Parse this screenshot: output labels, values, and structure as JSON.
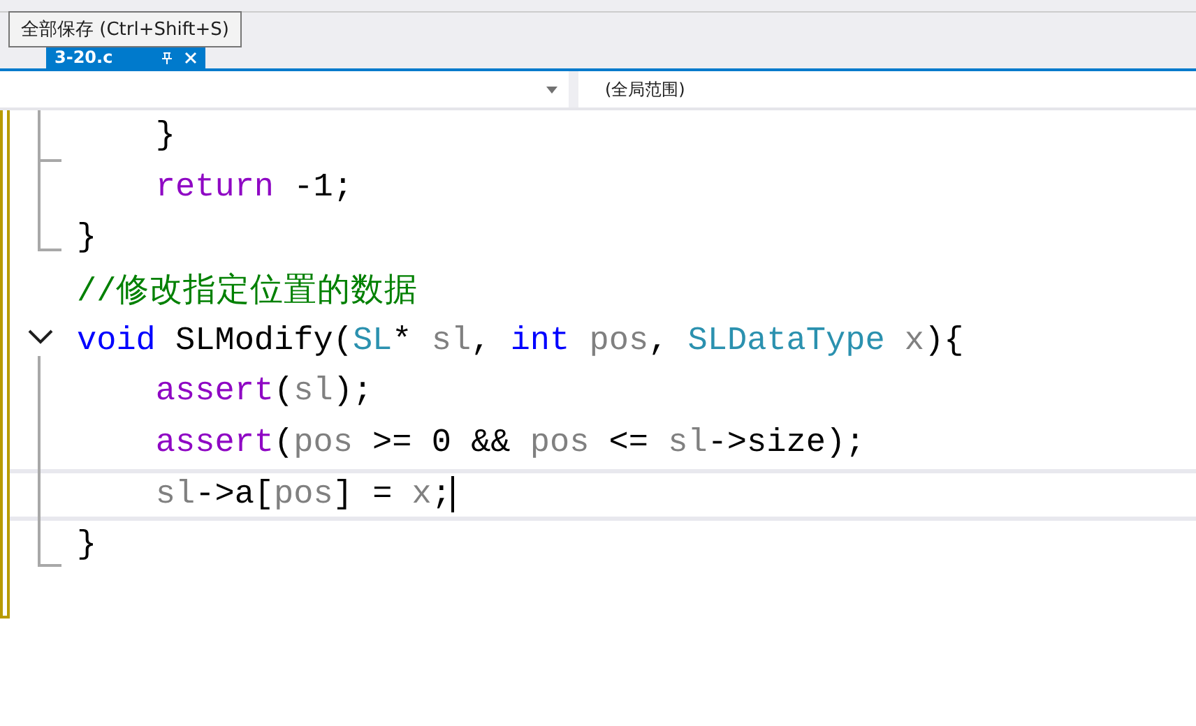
{
  "tooltip": {
    "text": "全部保存 (Ctrl+Shift+S)"
  },
  "tabs": [
    {
      "label": "3-20.c",
      "selected": true
    }
  ],
  "navigation_bar": {
    "scope": "(全局范围)"
  },
  "editor": {
    "lines": [
      {
        "tokens": [
          {
            "text": "    }",
            "kind": "brace"
          }
        ]
      },
      {
        "tokens": [
          {
            "text": "    return",
            "kind": "flow"
          },
          {
            "text": " -1;",
            "kind": "plain"
          }
        ]
      },
      {
        "tokens": [
          {
            "text": "}",
            "kind": "brace"
          }
        ]
      },
      {
        "tokens": [
          {
            "text": "//修改指定位置的数据",
            "kind": "comment"
          }
        ]
      },
      {
        "expanded": true,
        "tokens": [
          {
            "text": "void",
            "kind": "keyword"
          },
          {
            "text": " SLModify(",
            "kind": "plain"
          },
          {
            "text": "SL",
            "kind": "type"
          },
          {
            "text": "* ",
            "kind": "plain"
          },
          {
            "text": "sl",
            "kind": "param"
          },
          {
            "text": ", ",
            "kind": "plain"
          },
          {
            "text": "int",
            "kind": "keyword"
          },
          {
            "text": " pos",
            "kind": "param"
          },
          {
            "text": ", ",
            "kind": "plain"
          },
          {
            "text": "SLDataType",
            "kind": "type"
          },
          {
            "text": " x",
            "kind": "param"
          },
          {
            "text": "){",
            "kind": "plain"
          }
        ]
      },
      {
        "tokens": [
          {
            "text": "    assert",
            "kind": "flow"
          },
          {
            "text": "(",
            "kind": "plain"
          },
          {
            "text": "sl",
            "kind": "param"
          },
          {
            "text": ");",
            "kind": "plain"
          }
        ]
      },
      {
        "tokens": [
          {
            "text": "    assert",
            "kind": "flow"
          },
          {
            "text": "(",
            "kind": "plain"
          },
          {
            "text": "pos",
            "kind": "param"
          },
          {
            "text": " >= 0 && ",
            "kind": "plain"
          },
          {
            "text": "pos",
            "kind": "param"
          },
          {
            "text": " <= ",
            "kind": "plain"
          },
          {
            "text": "sl",
            "kind": "param"
          },
          {
            "text": "->size);",
            "kind": "plain"
          }
        ]
      },
      {
        "current": true,
        "tokens": [
          {
            "text": "    sl",
            "kind": "param"
          },
          {
            "text": "->a[",
            "kind": "plain"
          },
          {
            "text": "pos",
            "kind": "param"
          },
          {
            "text": "] = ",
            "kind": "plain"
          },
          {
            "text": "x",
            "kind": "param"
          },
          {
            "text": ";",
            "kind": "plain"
          }
        ]
      },
      {
        "tokens": [
          {
            "text": "}",
            "kind": "brace"
          }
        ]
      }
    ]
  }
}
